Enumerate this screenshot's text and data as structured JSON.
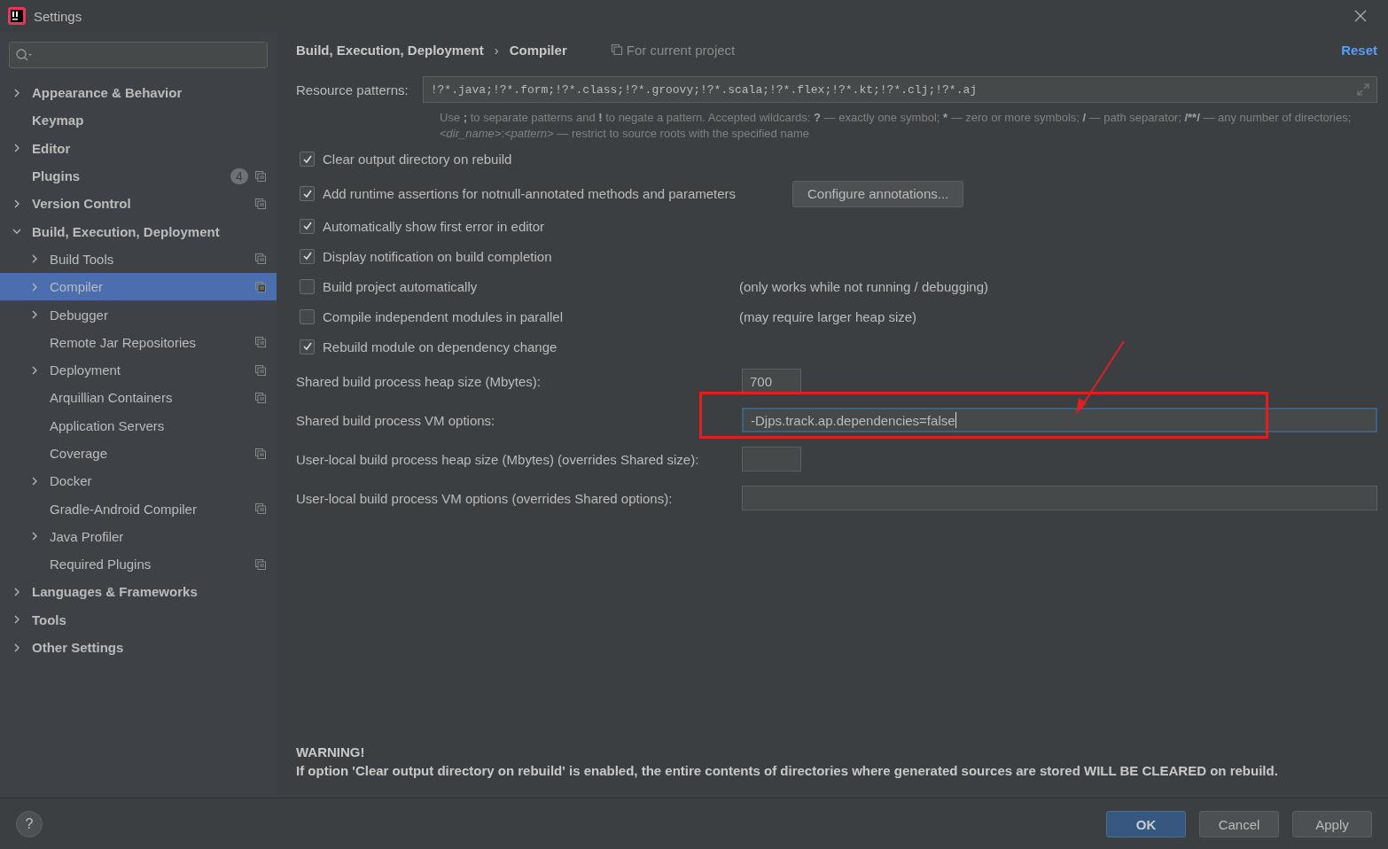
{
  "window": {
    "title": "Settings"
  },
  "sidebar": {
    "items": [
      {
        "label": "Appearance & Behavior",
        "expandable": true,
        "expanded": false,
        "selected": false,
        "project_scoped": false
      },
      {
        "label": "Keymap",
        "expandable": false,
        "expanded": false,
        "selected": false,
        "project_scoped": false
      },
      {
        "label": "Editor",
        "expandable": true,
        "expanded": false,
        "selected": false,
        "project_scoped": false
      },
      {
        "label": "Plugins",
        "expandable": false,
        "expanded": false,
        "selected": false,
        "project_scoped": true,
        "badge": "4"
      },
      {
        "label": "Version Control",
        "expandable": true,
        "expanded": false,
        "selected": false,
        "project_scoped": true
      },
      {
        "label": "Build, Execution, Deployment",
        "expandable": true,
        "expanded": true,
        "selected": false,
        "project_scoped": false,
        "children": [
          {
            "label": "Build Tools",
            "expandable": true,
            "expanded": false,
            "selected": false,
            "project_scoped": true
          },
          {
            "label": "Compiler",
            "expandable": true,
            "expanded": false,
            "selected": true,
            "project_scoped": true
          },
          {
            "label": "Debugger",
            "expandable": true,
            "expanded": false,
            "selected": false,
            "project_scoped": false
          },
          {
            "label": "Remote Jar Repositories",
            "expandable": false,
            "expanded": false,
            "selected": false,
            "project_scoped": true
          },
          {
            "label": "Deployment",
            "expandable": true,
            "expanded": false,
            "selected": false,
            "project_scoped": true
          },
          {
            "label": "Arquillian Containers",
            "expandable": false,
            "expanded": false,
            "selected": false,
            "project_scoped": true
          },
          {
            "label": "Application Servers",
            "expandable": false,
            "expanded": false,
            "selected": false,
            "project_scoped": false
          },
          {
            "label": "Coverage",
            "expandable": false,
            "expanded": false,
            "selected": false,
            "project_scoped": true
          },
          {
            "label": "Docker",
            "expandable": true,
            "expanded": false,
            "selected": false,
            "project_scoped": false
          },
          {
            "label": "Gradle-Android Compiler",
            "expandable": false,
            "expanded": false,
            "selected": false,
            "project_scoped": true
          },
          {
            "label": "Java Profiler",
            "expandable": true,
            "expanded": false,
            "selected": false,
            "project_scoped": false
          },
          {
            "label": "Required Plugins",
            "expandable": false,
            "expanded": false,
            "selected": false,
            "project_scoped": true
          }
        ]
      },
      {
        "label": "Languages & Frameworks",
        "expandable": true,
        "expanded": false,
        "selected": false,
        "project_scoped": false
      },
      {
        "label": "Tools",
        "expandable": true,
        "expanded": false,
        "selected": false,
        "project_scoped": false
      },
      {
        "label": "Other Settings",
        "expandable": true,
        "expanded": false,
        "selected": false,
        "project_scoped": false
      }
    ]
  },
  "header": {
    "breadcrumb": [
      "Build, Execution, Deployment",
      "Compiler"
    ],
    "separator": "›",
    "scope": "For current project",
    "reset": "Reset"
  },
  "resource_patterns": {
    "label": "Resource patterns:",
    "value": "!?*.java;!?*.form;!?*.class;!?*.groovy;!?*.scala;!?*.flex;!?*.kt;!?*.clj;!?*.aj",
    "hint": [
      {
        "kind": "plain",
        "text": "Use "
      },
      {
        "kind": "bold",
        "text": ";"
      },
      {
        "kind": "plain",
        "text": " to separate patterns and "
      },
      {
        "kind": "bold",
        "text": "!"
      },
      {
        "kind": "plain",
        "text": " to negate a pattern. Accepted wildcards: "
      },
      {
        "kind": "bold",
        "text": "?"
      },
      {
        "kind": "plain",
        "text": " — exactly one symbol; "
      },
      {
        "kind": "bold",
        "text": "*"
      },
      {
        "kind": "plain",
        "text": " — zero or more symbols; "
      },
      {
        "kind": "bold",
        "text": "/"
      },
      {
        "kind": "plain",
        "text": " — path separator; "
      },
      {
        "kind": "bold",
        "text": "/**/"
      },
      {
        "kind": "plain",
        "text": " — any number of directories; "
      },
      {
        "kind": "italic",
        "text": "<dir_name>"
      },
      {
        "kind": "plain",
        "text": ":"
      },
      {
        "kind": "italic",
        "text": "<pattern>"
      },
      {
        "kind": "plain",
        "text": " — restrict to source roots with the specified name"
      }
    ]
  },
  "options": [
    {
      "label": "Clear output directory on rebuild",
      "checked": true
    },
    {
      "label": "Add runtime assertions for notnull-annotated methods and parameters",
      "checked": true,
      "button": "Configure annotations..."
    },
    {
      "label": "Automatically show first error in editor",
      "checked": true
    },
    {
      "label": "Display notification on build completion",
      "checked": true
    },
    {
      "label": "Build project automatically",
      "checked": false,
      "note": "(only works while not running / debugging)"
    },
    {
      "label": "Compile independent modules in parallel",
      "checked": false,
      "note": "(may require larger heap size)"
    },
    {
      "label": "Rebuild module on dependency change",
      "checked": true
    }
  ],
  "fields": [
    {
      "label": "Shared build process heap size (Mbytes):",
      "value": "700",
      "wide": false,
      "focused": false
    },
    {
      "label": "Shared build process VM options:",
      "value": "-Djps.track.ap.dependencies=false",
      "wide": true,
      "focused": true
    },
    {
      "label": "User-local build process heap size (Mbytes) (overrides Shared size):",
      "wide": false,
      "focused": false
    },
    {
      "label": "User-local build process VM options (overrides Shared options):",
      "wide": true,
      "focused": false
    }
  ],
  "warning": {
    "title": "WARNING!",
    "text": "If option 'Clear output directory on rebuild' is enabled, the entire contents of directories where generated sources are stored WILL BE CLEARED on rebuild."
  },
  "footer": {
    "help": "?",
    "buttons": [
      {
        "label": "OK",
        "kind": "primary"
      },
      {
        "label": "Cancel",
        "kind": "normal"
      },
      {
        "label": "Apply",
        "kind": "normal"
      }
    ]
  }
}
